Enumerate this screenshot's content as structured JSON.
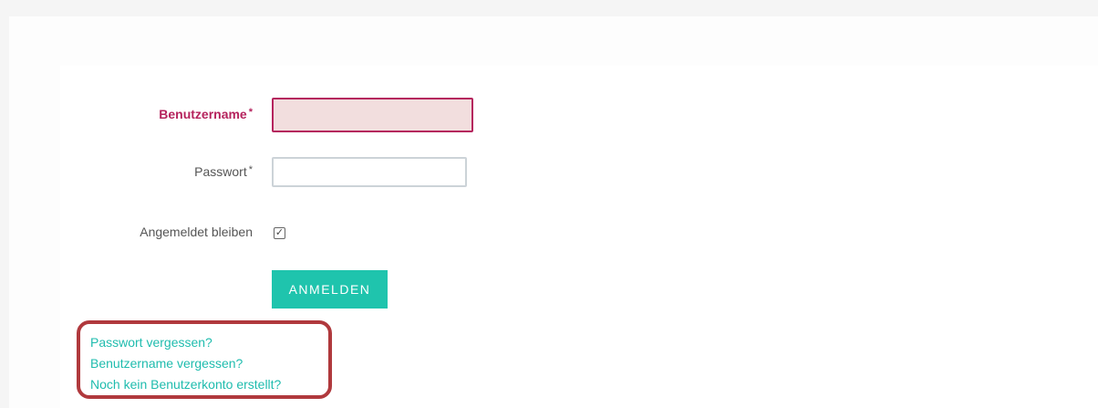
{
  "login_form": {
    "username_label": "Benutzername",
    "password_label": "Passwort",
    "required_marker": "*",
    "username_value": "",
    "password_value": "",
    "remember_label": "Angemeldet bleiben",
    "remember_checked": true,
    "remember_check_glyph": "✓",
    "submit_label": "ANMELDEN"
  },
  "help_links": {
    "forgot_password": "Passwort vergessen?",
    "forgot_username": "Benutzername vergessen?",
    "register": "Noch kein Benutzerkonto erstellt?"
  },
  "colors": {
    "accent": "#1fc4ad",
    "error": "#b5235d",
    "error_background": "#f2dede",
    "annotation": "#b0393d"
  }
}
